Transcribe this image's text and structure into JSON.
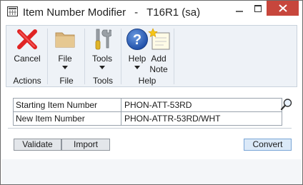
{
  "window": {
    "title": "Item Number Modifier",
    "company": "T16R1 (sa)",
    "separator": "-"
  },
  "ribbon": {
    "buttons": [
      {
        "id": "cancel",
        "label": "Cancel",
        "icon": "red-x-icon"
      },
      {
        "id": "file",
        "label": "File",
        "icon": "folder-icon",
        "has_menu": true
      },
      {
        "id": "tools",
        "label": "Tools",
        "icon": "tools-icon",
        "has_menu": true
      },
      {
        "id": "help",
        "label": "Help",
        "icon": "help-question-icon",
        "has_menu": true
      },
      {
        "id": "add_note",
        "label_line1": "Add",
        "label_line2": "Note",
        "icon": "add-note-icon"
      }
    ],
    "groups": [
      "Actions",
      "File",
      "Tools",
      "Help"
    ]
  },
  "form": {
    "starting_item_label": "Starting Item Number",
    "starting_item_value": "PHON-ATT-53RD",
    "new_item_label": "New Item Number",
    "new_item_value": "PHON-ATTR-53RD/WHT"
  },
  "buttons": {
    "validate": "Validate",
    "import": "Import",
    "convert": "Convert"
  },
  "colors": {
    "ribbon_bg": "#eef2f7",
    "close_button": "#c7463c",
    "primary_button": "#dbe9f8"
  }
}
